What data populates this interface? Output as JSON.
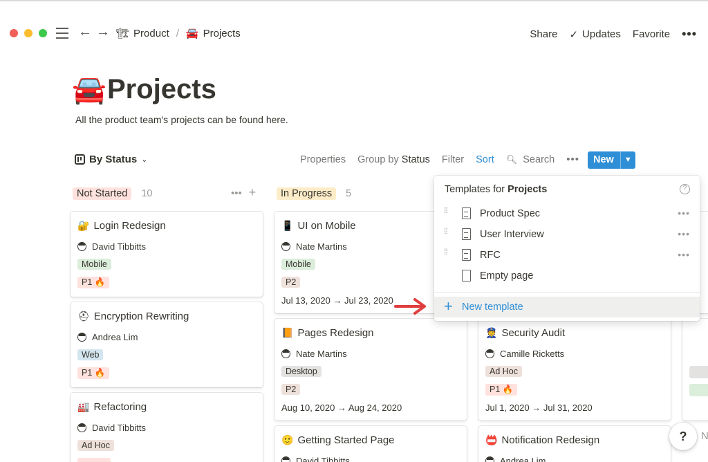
{
  "topbar": {
    "breadcrumbs": [
      {
        "icon": "🏗",
        "label": "Product"
      },
      {
        "icon": "🚘",
        "label": "Projects"
      }
    ],
    "separator": "/",
    "share": "Share",
    "updates": "Updates",
    "favorite": "Favorite",
    "more": "•••"
  },
  "page": {
    "icon": "🚘",
    "title": "Projects",
    "description": "All the product team's projects can be found here."
  },
  "toolbar": {
    "view": "By Status",
    "properties": "Properties",
    "group_by": "Group by",
    "group_by_value": "Status",
    "filter": "Filter",
    "sort": "Sort",
    "search": "Search",
    "more": "•••",
    "new": "New"
  },
  "columns": [
    {
      "status": "Not Started",
      "color": "#ffe2dd",
      "count": "10",
      "cards": [
        {
          "icon": "🔐",
          "title": "Login Redesign",
          "person": "David Tibbitts",
          "tags": [
            "Mobile",
            "P1 🔥"
          ]
        },
        {
          "icon": "⛑",
          "title": "Encryption Rewriting",
          "person": "Andrea Lim",
          "tags": [
            "Web",
            "P1 🔥"
          ]
        },
        {
          "icon": "🏭",
          "title": "Refactoring",
          "person": "David Tibbitts",
          "tags": [
            "Ad Hoc"
          ]
        }
      ]
    },
    {
      "status": "In Progress",
      "color": "#fdecc8",
      "count": "5",
      "cards": [
        {
          "icon": "📱",
          "title": "UI on Mobile",
          "person": "Nate Martins",
          "tags": [
            "Mobile",
            "P2"
          ],
          "date": "Jul 13, 2020 → Jul 23, 2020"
        },
        {
          "icon": "📙",
          "title": "Pages Redesign",
          "person": "Nate Martins",
          "tags": [
            "Desktop",
            "P2"
          ],
          "date": "Aug 10, 2020 → Aug 24, 2020"
        },
        {
          "icon": "🙂",
          "title": "Getting Started Page",
          "person": "David Tibbitts"
        }
      ]
    },
    {
      "cards": [
        {
          "icon": "👮",
          "title": "Security Audit",
          "person": "Camille Ricketts",
          "tags": [
            "Ad Hoc",
            "P1 🔥"
          ],
          "date": "Jul 1, 2020 → Jul 31, 2020"
        },
        {
          "icon": "📛",
          "title": "Notification Redesign",
          "person": "Andrea Lim"
        }
      ]
    }
  ],
  "templates_popover": {
    "heading_prefix": "Templates for",
    "heading_bold": "Projects",
    "help": "?",
    "items": [
      "Product Spec",
      "User Interview",
      "RFC",
      "Empty page"
    ],
    "new_template": "New template"
  },
  "help_button": "?",
  "edge_text": "N"
}
